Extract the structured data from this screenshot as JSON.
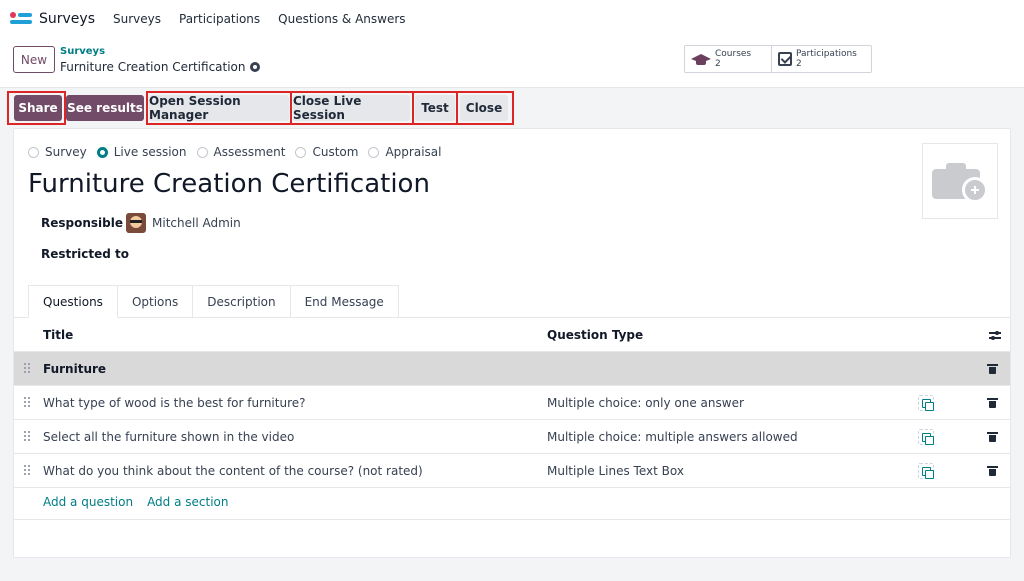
{
  "topnav": {
    "app_name": "Surveys",
    "items": [
      "Surveys",
      "Participations",
      "Questions & Answers"
    ]
  },
  "control_panel": {
    "new_label": "New",
    "breadcrumb_parent": "Surveys",
    "breadcrumb_current": "Furniture Creation Certification",
    "stats": [
      {
        "icon": "graduation-cap-icon",
        "label": "Courses",
        "value": "2"
      },
      {
        "icon": "checkbox-icon",
        "label": "Participations",
        "value": "2"
      }
    ]
  },
  "actions": {
    "share": "Share",
    "see_results": "See results",
    "open_session_manager": "Open Session Manager",
    "close_live_session": "Close Live Session",
    "test": "Test",
    "close": "Close"
  },
  "form": {
    "survey_types": [
      "Survey",
      "Live session",
      "Assessment",
      "Custom",
      "Appraisal"
    ],
    "selected_type": "Live session",
    "title": "Furniture Creation Certification",
    "responsible_label": "Responsible",
    "responsible_value": "Mitchell Admin",
    "restricted_label": "Restricted to"
  },
  "tabs": [
    "Questions",
    "Options",
    "Description",
    "End Message"
  ],
  "active_tab": "Questions",
  "table": {
    "columns": [
      "Title",
      "Question Type"
    ],
    "rows": [
      {
        "title": "Furniture",
        "type": "",
        "section": true
      },
      {
        "title": "What type of wood is the best for furniture?",
        "type": "Multiple choice: only one answer",
        "section": false
      },
      {
        "title": "Select all the furniture shown in the video",
        "type": "Multiple choice: multiple answers allowed",
        "section": false
      },
      {
        "title": "What do you think about the content of the course? (not rated)",
        "type": "Multiple Lines Text Box",
        "section": false
      }
    ],
    "add_question": "Add a question",
    "add_section": "Add a section"
  },
  "colors": {
    "primary": "#714b67",
    "accent": "#017e84",
    "highlight_box": "#dc2626"
  }
}
